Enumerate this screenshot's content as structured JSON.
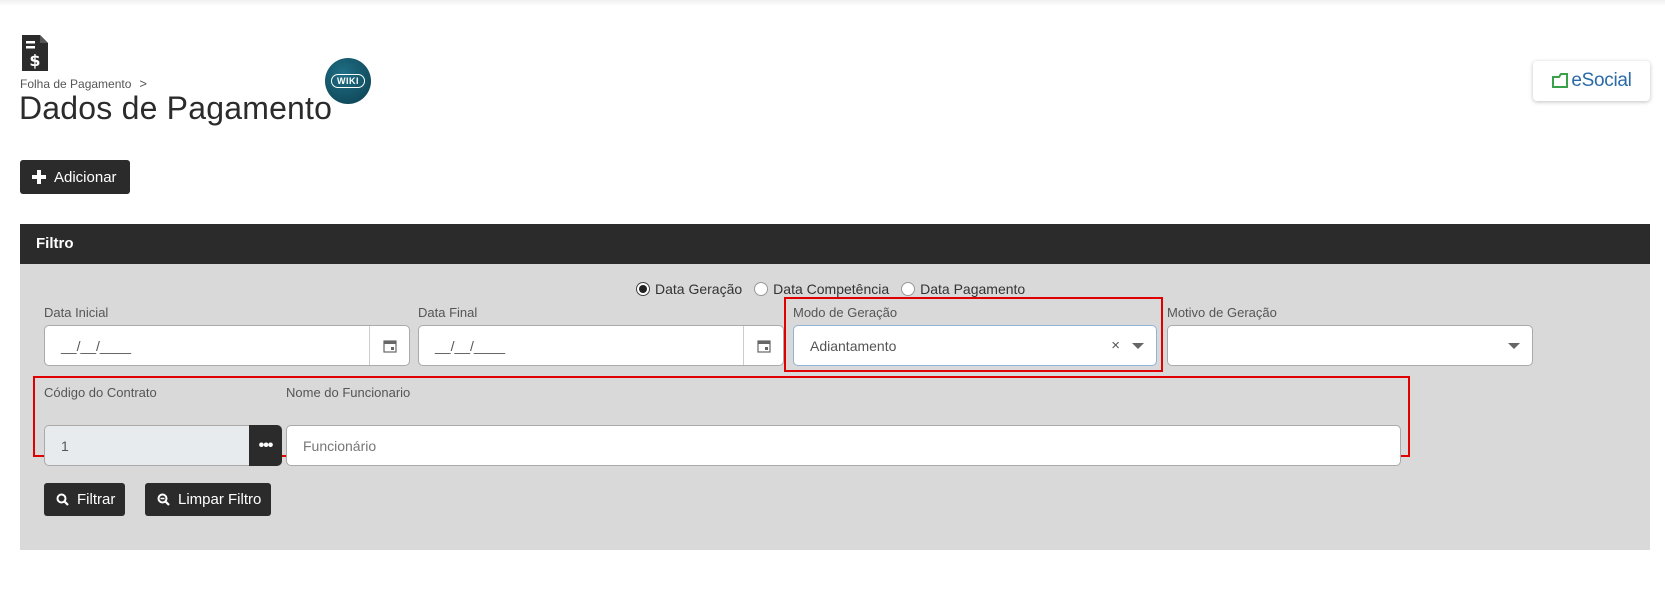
{
  "header": {
    "breadcrumb": "Folha de Pagamento",
    "breadcrumb_sep": ">",
    "title": "Dados de Pagamento",
    "wiki_label": "WIKI",
    "esocial_label": "eSocial",
    "page_icon": "file-dollar-icon"
  },
  "toolbar": {
    "add_label": "Adicionar",
    "add_icon": "plus-icon"
  },
  "filter": {
    "title": "Filtro",
    "date_type": {
      "options": [
        "Data Geração",
        "Data Competência",
        "Data Pagamento"
      ],
      "selected": "Data Geração"
    },
    "data_inicial": {
      "label": "Data Inicial",
      "value": "__/__/____"
    },
    "data_final": {
      "label": "Data Final",
      "value": "__/__/____"
    },
    "modo_geracao": {
      "label": "Modo de Geração",
      "value": "Adiantamento",
      "clear": "×"
    },
    "motivo_geracao": {
      "label": "Motivo de Geração",
      "value": ""
    },
    "codigo_contrato": {
      "label": "Código do Contrato",
      "value": "1",
      "lookup": "•••"
    },
    "nome_funcionario": {
      "label": "Nome do Funcionario",
      "placeholder": "Funcionário"
    },
    "filtrar_label": "Filtrar",
    "limpar_label": "Limpar Filtro"
  },
  "colors": {
    "dark": "#2b2b2b",
    "panel": "#d9d9d9",
    "highlight": "#e00000",
    "esocial_blue": "#2a6aa8",
    "esocial_green": "#3aa04a"
  }
}
